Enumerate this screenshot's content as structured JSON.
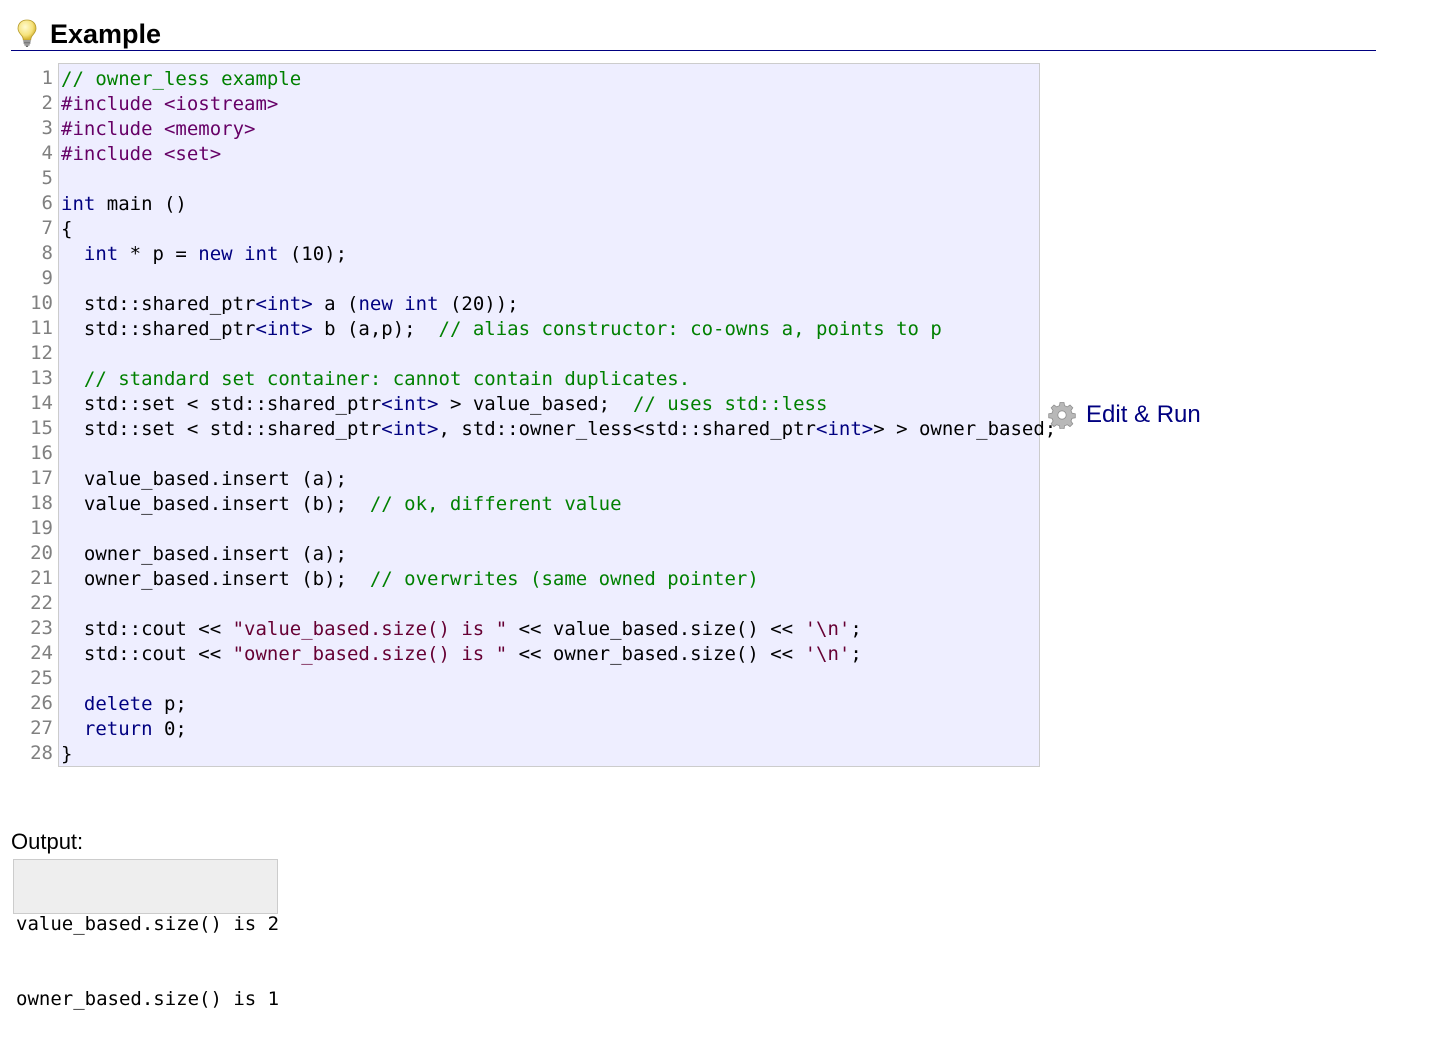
{
  "header": {
    "title": "Example",
    "icon": "lightbulb-icon"
  },
  "code": {
    "line_numbers": [
      "1",
      "2",
      "3",
      "4",
      "5",
      "6",
      "7",
      "8",
      "9",
      "10",
      "11",
      "12",
      "13",
      "14",
      "15",
      "16",
      "17",
      "18",
      "19",
      "20",
      "21",
      "22",
      "23",
      "24",
      "25",
      "26",
      "27",
      "28"
    ],
    "lines": [
      [
        [
          "c",
          "// owner_less example"
        ]
      ],
      [
        [
          "p",
          "#include <iostream>"
        ]
      ],
      [
        [
          "p",
          "#include <memory>"
        ]
      ],
      [
        [
          "p",
          "#include <set>"
        ]
      ],
      [],
      [
        [
          "k",
          "int"
        ],
        [
          "n",
          " main ()"
        ]
      ],
      [
        [
          "n",
          "{"
        ]
      ],
      [
        [
          "n",
          "  "
        ],
        [
          "k",
          "int"
        ],
        [
          "n",
          " * p = "
        ],
        [
          "k",
          "new"
        ],
        [
          "n",
          " "
        ],
        [
          "k",
          "int"
        ],
        [
          "n",
          " (10);"
        ]
      ],
      [],
      [
        [
          "n",
          "  std::shared_ptr"
        ],
        [
          "k",
          "<int>"
        ],
        [
          "n",
          " a ("
        ],
        [
          "k",
          "new"
        ],
        [
          "n",
          " "
        ],
        [
          "k",
          "int"
        ],
        [
          "n",
          " (20));"
        ]
      ],
      [
        [
          "n",
          "  std::shared_ptr"
        ],
        [
          "k",
          "<int>"
        ],
        [
          "n",
          " b (a,p);  "
        ],
        [
          "c",
          "// alias constructor: co-owns a, points to p"
        ]
      ],
      [],
      [
        [
          "n",
          "  "
        ],
        [
          "c",
          "// standard set container: cannot contain duplicates."
        ]
      ],
      [
        [
          "n",
          "  std::set < std::shared_ptr"
        ],
        [
          "k",
          "<int>"
        ],
        [
          "n",
          " > value_based;  "
        ],
        [
          "c",
          "// uses std::less"
        ]
      ],
      [
        [
          "n",
          "  std::set < std::shared_ptr"
        ],
        [
          "k",
          "<int>"
        ],
        [
          "n",
          ", std::owner_less<std::shared_ptr"
        ],
        [
          "k",
          "<int>"
        ],
        [
          "n",
          "> > owner_based;"
        ]
      ],
      [],
      [
        [
          "n",
          "  value_based.insert (a);"
        ]
      ],
      [
        [
          "n",
          "  value_based.insert (b);  "
        ],
        [
          "c",
          "// ok, different value"
        ]
      ],
      [],
      [
        [
          "n",
          "  owner_based.insert (a);"
        ]
      ],
      [
        [
          "n",
          "  owner_based.insert (b);  "
        ],
        [
          "c",
          "// overwrites (same owned pointer)"
        ]
      ],
      [],
      [
        [
          "n",
          "  std::cout << "
        ],
        [
          "s",
          "\"value_based.size() is \""
        ],
        [
          "n",
          " << value_based.size() << "
        ],
        [
          "s",
          "'\\n'"
        ],
        [
          "n",
          ";"
        ]
      ],
      [
        [
          "n",
          "  std::cout << "
        ],
        [
          "s",
          "\"owner_based.size() is \""
        ],
        [
          "n",
          " << owner_based.size() << "
        ],
        [
          "s",
          "'\\n'"
        ],
        [
          "n",
          ";"
        ]
      ],
      [],
      [
        [
          "n",
          "  "
        ],
        [
          "k",
          "delete"
        ],
        [
          "n",
          " p;"
        ]
      ],
      [
        [
          "n",
          "  "
        ],
        [
          "k",
          "return"
        ],
        [
          "n",
          " 0;"
        ]
      ],
      [
        [
          "n",
          "}"
        ]
      ]
    ]
  },
  "edit_run": {
    "label": "Edit & Run",
    "icon": "gear-icon"
  },
  "output": {
    "label": "Output:",
    "lines": [
      "value_based.size() is 2",
      "owner_based.size() is 1"
    ]
  },
  "colors": {
    "comment": "#008000",
    "keyword": "#000080",
    "preprocessor": "#660066",
    "string": "#660033",
    "code_background": "#eeeeff",
    "output_background": "#eeeeee"
  }
}
